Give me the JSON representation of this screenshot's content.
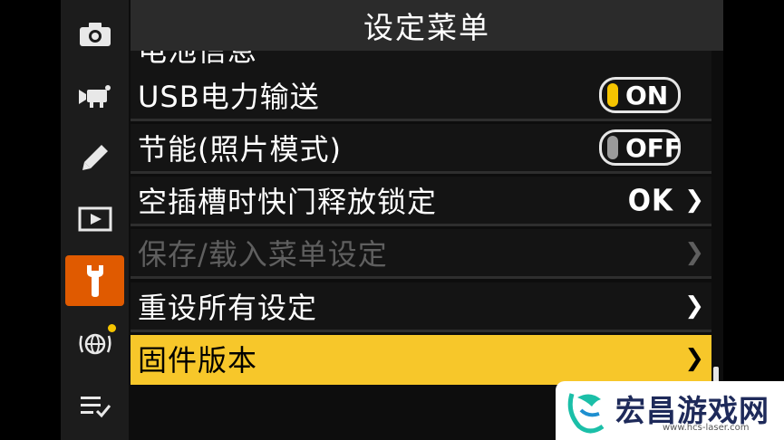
{
  "title": "设定菜单",
  "sidebar": {
    "tabs": [
      {
        "name": "photo-shooting-menu",
        "icon": "camera-icon",
        "active": false
      },
      {
        "name": "movie-recording-menu",
        "icon": "movie-camera-icon",
        "active": false
      },
      {
        "name": "custom-settings-menu",
        "icon": "pencil-icon",
        "active": false
      },
      {
        "name": "playback-menu",
        "icon": "play-icon",
        "active": false
      },
      {
        "name": "setup-menu",
        "icon": "wrench-icon",
        "active": true
      },
      {
        "name": "network-menu",
        "icon": "globe-network-icon",
        "active": false,
        "badge": true
      },
      {
        "name": "my-menu",
        "icon": "checklist-icon",
        "active": false
      }
    ]
  },
  "menu": {
    "items": [
      {
        "label": "电池信息",
        "partial": true
      },
      {
        "label": "USB电力输送",
        "toggle": "ON",
        "toggle_state": "on"
      },
      {
        "label": "节能(照片模式)",
        "toggle": "OFF",
        "toggle_state": "off"
      },
      {
        "label": "空插槽时快门释放锁定",
        "value": "OK"
      },
      {
        "label": "保存/载入菜单设定",
        "disabled": true
      },
      {
        "label": "重设所有设定"
      },
      {
        "label": "固件版本",
        "selected": true
      }
    ]
  },
  "watermark": {
    "title": "宏昌游戏网",
    "url": "www.hcs-laser.com"
  },
  "colors": {
    "accent_orange": "#e05a00",
    "highlight_yellow": "#f7c72a",
    "toggle_on": "#f5c400"
  }
}
